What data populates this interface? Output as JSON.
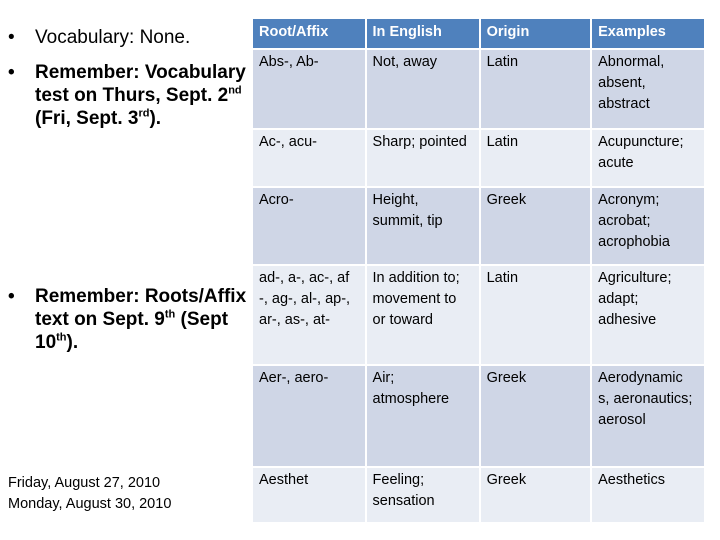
{
  "left_panel": {
    "bullets": [
      {
        "marker": "•",
        "text": "Vocabulary: None."
      },
      {
        "marker": "•",
        "parts": [
          "Remember: Vocabulary test on Thurs, Sept. 2",
          "nd",
          " (Fri, Sept. 3",
          "rd",
          ")."
        ]
      },
      {
        "marker": "•",
        "parts": [
          "Remember: Roots/Affix text on Sept. 9",
          "th",
          " (Sept 10",
          "th",
          ")."
        ]
      }
    ],
    "dates": [
      "Friday, August 27, 2010",
      "Monday, August 30, 2010"
    ]
  },
  "table": {
    "headers": [
      "Root/Affix",
      "In English",
      "Origin",
      "Examples"
    ],
    "rows": [
      [
        "Abs-, Ab-",
        "Not, away",
        "Latin",
        "Abnormal, absent, abstract"
      ],
      [
        "Ac-, acu-",
        "Sharp; pointed",
        "Latin",
        "Acupuncture; acute"
      ],
      [
        "Acro-",
        "Height, summit, tip",
        "Greek",
        "Acronym; acrobat; acrophobia"
      ],
      [
        "ad-, a-, ac-, af -, ag-, al-, ap-, ar-, as-, at-",
        "In addition to; movement to or toward",
        "Latin",
        "Agriculture; adapt; adhesive"
      ],
      [
        "Aer-, aero-",
        "Air; atmosphere",
        "Greek",
        "Aerodynamic s, aeronautics; aerosol"
      ],
      [
        "Aesthet",
        "Feeling; sensation",
        "Greek",
        "Aesthetics"
      ]
    ]
  },
  "colors": {
    "header_bg": "#4f81bd",
    "row_dark": "#cfd6e6",
    "row_light": "#e9edf4"
  }
}
